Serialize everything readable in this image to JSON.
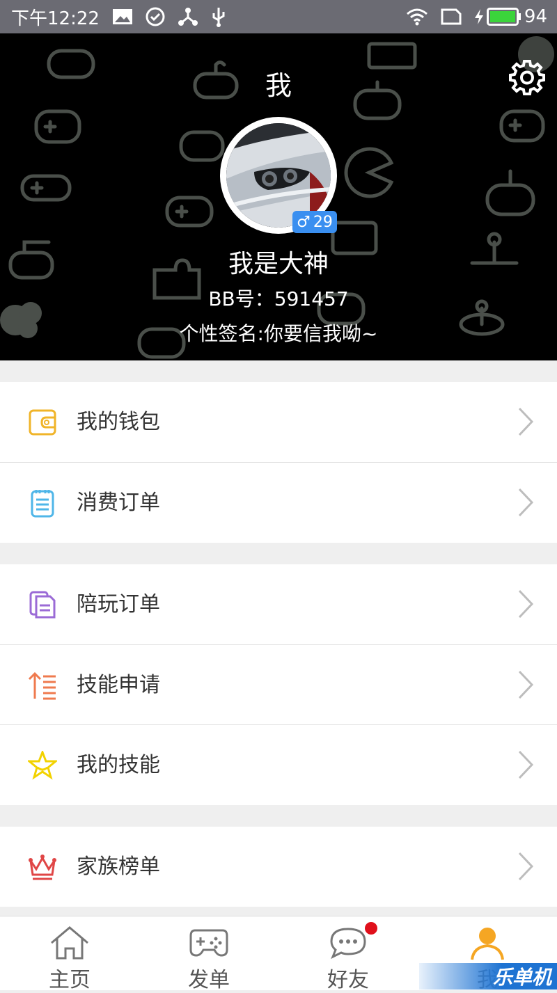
{
  "status_bar": {
    "time": "下午12:22",
    "battery": "94"
  },
  "header": {
    "title": "我"
  },
  "profile": {
    "nickname": "我是大神",
    "gender_symbol": "♂",
    "age": "29",
    "bb_number": "BB号：591457",
    "signature": "个性签名:你要信我呦~"
  },
  "menu": {
    "wallet": "我的钱包",
    "consume_orders": "消费订单",
    "play_orders": "陪玩订单",
    "skill_apply": "技能申请",
    "my_skills": "我的技能",
    "family_rank": "家族榜单"
  },
  "tabbar": {
    "home": "主页",
    "post": "发单",
    "friends": "好友",
    "me": "我"
  },
  "watermark": "乐单机",
  "colors": {
    "accent": "#f5a623",
    "badge": "#3a8ff0",
    "notification_dot": "#e0101b",
    "wallet_icon": "#f0b429",
    "orders_icon": "#4fb6e8",
    "play_icon": "#9b6bd6",
    "skill_apply_icon": "#ef7a4e",
    "skills_icon": "#f2d200",
    "family_icon": "#e04646"
  }
}
